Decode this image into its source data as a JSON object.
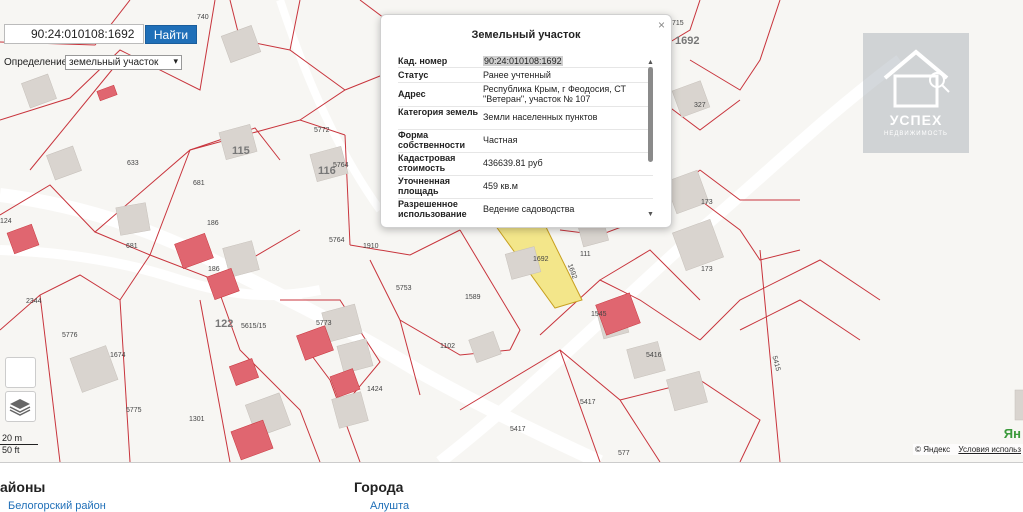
{
  "search": {
    "value": "90:24:010108:1692",
    "button": "Найти"
  },
  "definition": {
    "label": "Определение:",
    "selected": "земельный участок"
  },
  "popup": {
    "title": "Земельный участок",
    "close": "×",
    "rows": [
      {
        "key": "Кад. номер",
        "value": "90:24:010108:1692"
      },
      {
        "key": "Статус",
        "value": "Ранее учтенный"
      },
      {
        "key": "Адрес",
        "value": "Республика Крым, г Феодосия, СТ \"Ветеран\", участок № 107"
      },
      {
        "key": "Категория земель",
        "value": "Земли населенных пунктов"
      },
      {
        "key": "Форма собственности",
        "value": "Частная"
      },
      {
        "key": "Кадастровая стоимость",
        "value": "436639.81 руб"
      },
      {
        "key": "Уточненная площадь",
        "value": "459 кв.м"
      },
      {
        "key": "Разрешенное использование",
        "value": "Ведение садоводства"
      }
    ]
  },
  "map": {
    "parcel_labels": [
      "740",
      "633",
      "681",
      "186",
      "186",
      "124",
      "681",
      "2344",
      "5776",
      "1674",
      "5775",
      "1301",
      "5615/15",
      "122",
      "5773",
      "1424",
      "5772",
      "5764",
      "5764",
      "1910",
      "5753",
      "1589",
      "1102",
      "1692",
      "1692",
      "111",
      "1545",
      "5416",
      "5417",
      "5417",
      "5415",
      "173",
      "173",
      "327",
      "115",
      "116",
      "1692",
      "715",
      "577"
    ],
    "selected_parcel": "1692",
    "selected_fill": "#f3e68a",
    "building_red": "#e06670",
    "parcel_line": "#c8343c"
  },
  "watermark": {
    "title": "УСПЕХ",
    "subtitle": "НЕДВИЖИМОСТЬ"
  },
  "scale": {
    "metric": "20 m",
    "imperial": "50 ft"
  },
  "attribution": {
    "copyright": "© Яндекс",
    "terms": "Условия использ",
    "logo": "Ян"
  },
  "bottom": {
    "left_heading": "айоны",
    "right_heading": "Города",
    "left_link": "Белогорский район",
    "right_link": "Алушта"
  }
}
